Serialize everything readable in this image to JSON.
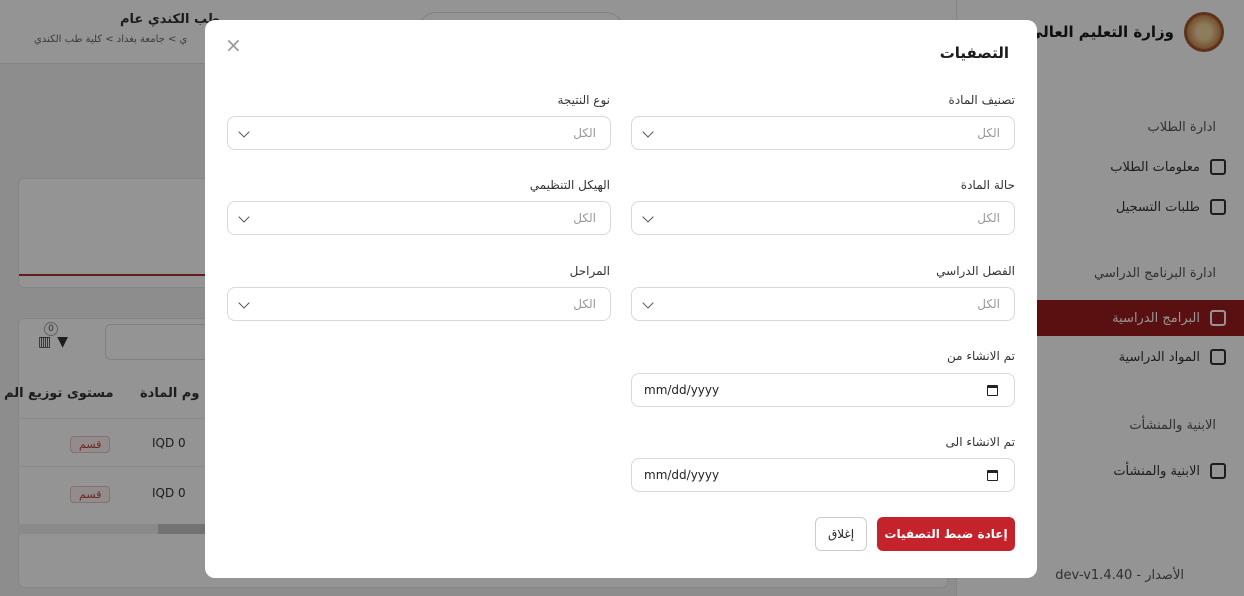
{
  "app": {
    "title": "وزارة التعليم العالي و",
    "page_title": "طب الكندي عام",
    "breadcrumb": "ي > جامعة بغداد > كلية طب الكندي",
    "version": "dev-v1.4.40 - الأصدار"
  },
  "sidebar": {
    "sections": [
      {
        "label": "ادارة الطلاب"
      },
      {
        "label": "ادارة البرنامج الدراسي"
      },
      {
        "label": "الابنية والمنشأت"
      }
    ],
    "items": [
      {
        "label": "معلومات الطلاب"
      },
      {
        "label": "طلبات التسجيل"
      },
      {
        "label": "البرامج الدراسية"
      },
      {
        "label": "المواد الدراسية"
      },
      {
        "label": "الابنية والمنشأت"
      }
    ]
  },
  "table": {
    "filter_count": "0",
    "columns": [
      {
        "label": "مستوى توزيع الم"
      },
      {
        "label": "وم المادة"
      }
    ],
    "rows": [
      {
        "amount": "IQD 0",
        "tag": "قسم"
      },
      {
        "amount": "IQD 0",
        "tag": "قسم"
      }
    ]
  },
  "modal": {
    "title": "التصفيات",
    "close_icon": "close-icon",
    "fields": {
      "subject_category": {
        "label": "تصنيف المادة",
        "value": "الكل"
      },
      "result_type": {
        "label": "نوع النتيجة",
        "value": "الكل"
      },
      "subject_status": {
        "label": "حالة المادة",
        "value": "الكل"
      },
      "org_structure": {
        "label": "الهيكل التنظيمي",
        "value": "الكل"
      },
      "semester": {
        "label": "الفصل الدراسي",
        "value": "الكل"
      },
      "stages": {
        "label": "المراحل",
        "value": "الكل"
      },
      "created_from": {
        "label": "تم الانشاء من",
        "value": "mm/dd/yyyy"
      },
      "created_to": {
        "label": "تم الانشاء الى",
        "value": "mm/dd/yyyy"
      }
    },
    "reset_label": "إعادة ضبط التصفيات",
    "close_label": "إغلاق"
  },
  "colors": {
    "primary": "#c4232b",
    "sidebar_active": "#9c1c1c"
  }
}
